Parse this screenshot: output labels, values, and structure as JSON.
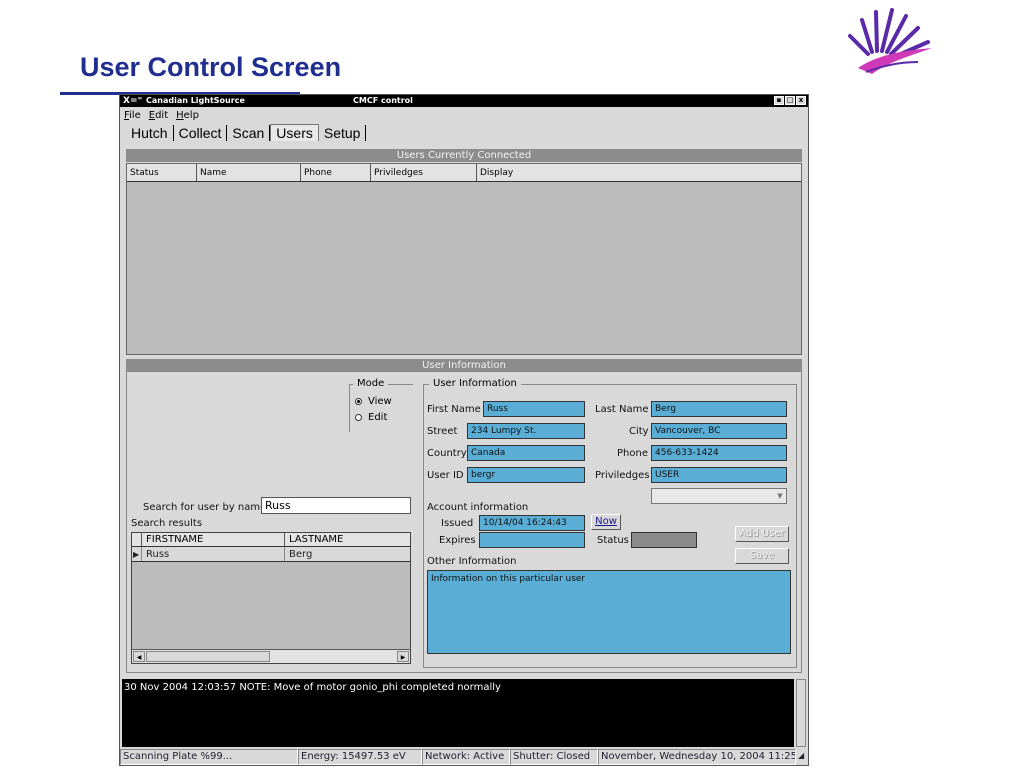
{
  "slide": {
    "title": "User Control Screen",
    "colors": {
      "title": "#1f2e8f",
      "logo_purple": "#5a2aa8",
      "logo_pink": "#d03ab8"
    }
  },
  "window": {
    "x_logo": "X=⁼",
    "app_name": "Canadian LightSource",
    "title": "CMCF control",
    "buttons": [
      "▪",
      "□",
      "x"
    ]
  },
  "menu": [
    "File",
    "Edit",
    "Help"
  ],
  "tabs": [
    "Hutch",
    "Collect",
    "Scan",
    "Users",
    "Setup"
  ],
  "active_tab": "Users",
  "users_section": {
    "header": "Users Currently Connected",
    "columns": [
      "Status",
      "Name",
      "Phone",
      "Priviledges",
      "Display"
    ],
    "rows": []
  },
  "user_info_section": {
    "header": "User Information",
    "mode": {
      "legend": "Mode",
      "options": [
        "View",
        "Edit"
      ],
      "selected": "View"
    },
    "search": {
      "label": "Search for user by name",
      "value": "Russ",
      "results_label": "Search results",
      "columns": [
        "FIRSTNAME",
        "LASTNAME"
      ],
      "rows": [
        {
          "firstname": "Russ",
          "lastname": "Berg"
        }
      ]
    },
    "user_info": {
      "legend": "User Information",
      "first_name_label": "First Name",
      "first_name": "Russ",
      "last_name_label": "Last Name",
      "last_name": "Berg",
      "street_label": "Street",
      "street": "234 Lumpy St.",
      "city_label": "City",
      "city": "Vancouver, BC",
      "country_label": "Country",
      "country": "Canada",
      "phone_label": "Phone",
      "phone": "456-633-1424",
      "user_id_label": "User ID",
      "user_id": "bergr",
      "priviledges_label": "Priviledges",
      "priviledges": "USER"
    },
    "account": {
      "label": "Account information",
      "issued_label": "Issued",
      "issued": "10/14/04 16:24:43",
      "now_button": "Now",
      "expires_label": "Expires",
      "expires": "",
      "status_label": "Status"
    },
    "buttons": {
      "add_user": "Add User",
      "save": "Save"
    },
    "other": {
      "label": "Other Information",
      "text": "Information  on this particular user"
    }
  },
  "log": {
    "message": "30 Nov 2004 12:03:57    NOTE: Move of motor gonio_phi completed normally"
  },
  "statusbar": {
    "scanning": "Scanning Plate %99...",
    "energy": "Energy: 15497.53 eV",
    "network": "Network: Active",
    "shutter": "Shutter: Closed",
    "date": "November, Wednesday 10, 2004  11:25"
  }
}
